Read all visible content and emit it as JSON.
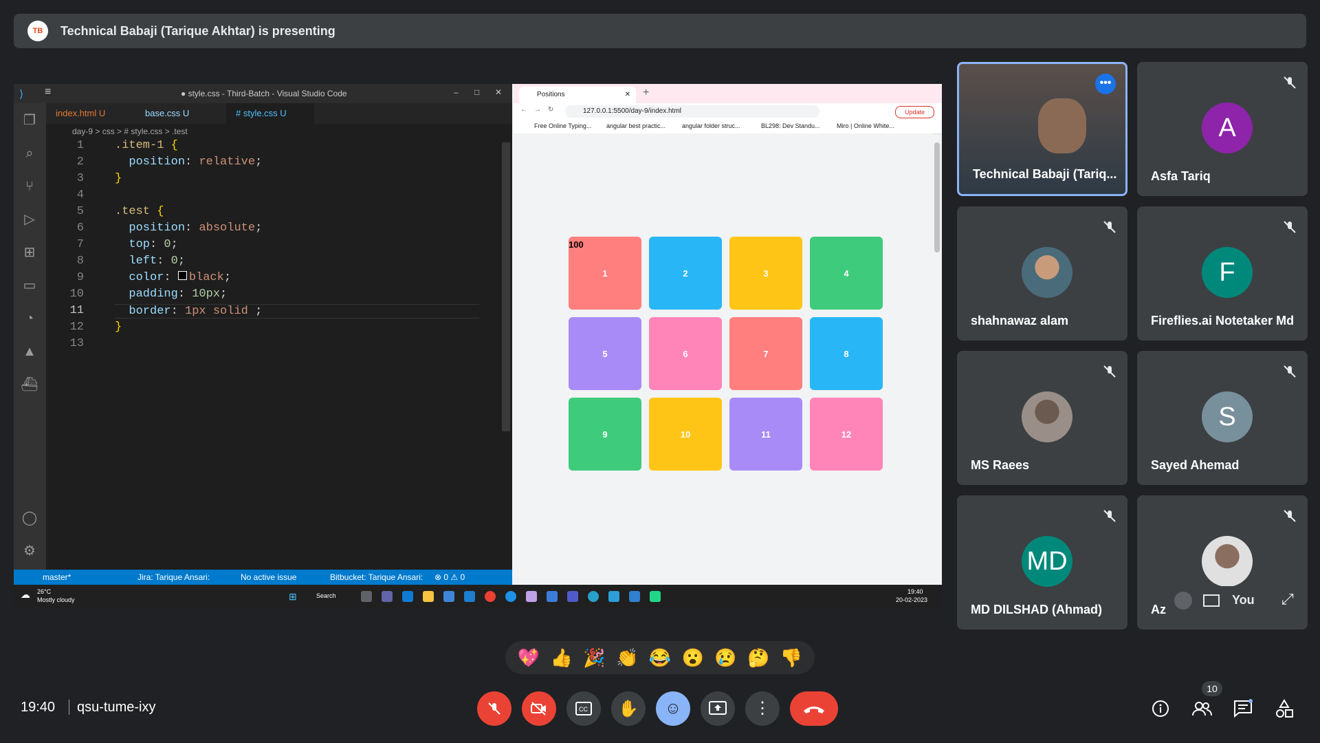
{
  "banner": {
    "logo_text": "TB",
    "text": "Technical Babaji (Tarique Akhtar) is presenting"
  },
  "vscode": {
    "title": "● style.css - Third-Batch - Visual Studio Code",
    "tabs": [
      "index.html U",
      "base.css U",
      "# style.css U"
    ],
    "breadcrumb": "day-9 > css > # style.css > .test",
    "line_numbers": [
      "1",
      "2",
      "3",
      "4",
      "5",
      "6",
      "7",
      "8",
      "9",
      "10",
      "11",
      "12",
      "13"
    ],
    "code": {
      "l1a": ".item-1",
      "l1b": " {",
      "l2a": "  position",
      "l2b": ": ",
      "l2c": "relative",
      "l2d": ";",
      "l3": "}",
      "l5a": ".test",
      "l5b": " {",
      "l6a": "  position",
      "l6b": ": ",
      "l6c": "absolute",
      "l6d": ";",
      "l7a": "  top",
      "l7b": ": ",
      "l7c": "0",
      "l7d": ";",
      "l8a": "  left",
      "l8b": ": ",
      "l8c": "0",
      "l8d": ";",
      "l9a": "  color",
      "l9b": ": ",
      "l9c": "black",
      "l9d": ";",
      "l10a": "  padding",
      "l10b": ": ",
      "l10c": "10px",
      "l10d": ";",
      "l11a": "  border",
      "l11b": ": ",
      "l11c": "1px solid ",
      "l11d": ";",
      "l12": "}"
    },
    "status": {
      "branch": "master*",
      "jira": "Jira: Tarique Ansari:",
      "issue": "No active issue",
      "bitbucket": "Bitbucket: Tarique Ansari:",
      "problems": "⊗ 0 ⚠ 0"
    }
  },
  "chrome": {
    "tab_title": "Positions",
    "url": "127.0.0.1:5500/day-9/index.html",
    "update_label": "Update",
    "bookmarks": [
      "Free Online Typing...",
      "angular best practic...",
      "angular folder struc...",
      "BL298: Dev Standu...",
      "Miro | Online White..."
    ],
    "box_label": "100",
    "boxes": [
      "1",
      "2",
      "3",
      "4",
      "5",
      "6",
      "7",
      "8",
      "9",
      "10",
      "11",
      "12"
    ],
    "box_colors": [
      "#ff7f7f",
      "#29b6f6",
      "#ffc516",
      "#3ecb7c",
      "#a98bf7",
      "#ff85b8",
      "#ff7f7f",
      "#29b6f6",
      "#3ecb7c",
      "#ffc516",
      "#a98bf7",
      "#ff85b8"
    ]
  },
  "taskbar": {
    "weather_temp": "26°C",
    "weather_desc": "Mostly cloudy",
    "search": "Search",
    "time": "19:40",
    "date": "20-02-2023"
  },
  "participants": [
    {
      "name": "Technical Babaji (Tariq...",
      "type": "video"
    },
    {
      "name": "Asfa Tariq",
      "initial": "A",
      "color": "#8e24aa"
    },
    {
      "name": "shahnawaz alam",
      "type": "photo"
    },
    {
      "name": "Fireflies.ai Notetaker Md",
      "initial": "F",
      "color": "#00897b"
    },
    {
      "name": "MS Raees",
      "type": "photo"
    },
    {
      "name": "Sayed Ahemad",
      "initial": "S",
      "color": "#78909c"
    },
    {
      "name": "MD DILSHAD (Ahmad)",
      "initial": "MD",
      "color": "#00897b"
    },
    {
      "name": "Az",
      "type": "photo"
    }
  ],
  "self_view_label": "You",
  "reactions": [
    "💖",
    "👍",
    "🎉",
    "👏",
    "😂",
    "😮",
    "😢",
    "🤔",
    "👎"
  ],
  "bottom": {
    "time": "19:40",
    "meeting_code": "qsu-tume-ixy",
    "people_count": "10"
  }
}
